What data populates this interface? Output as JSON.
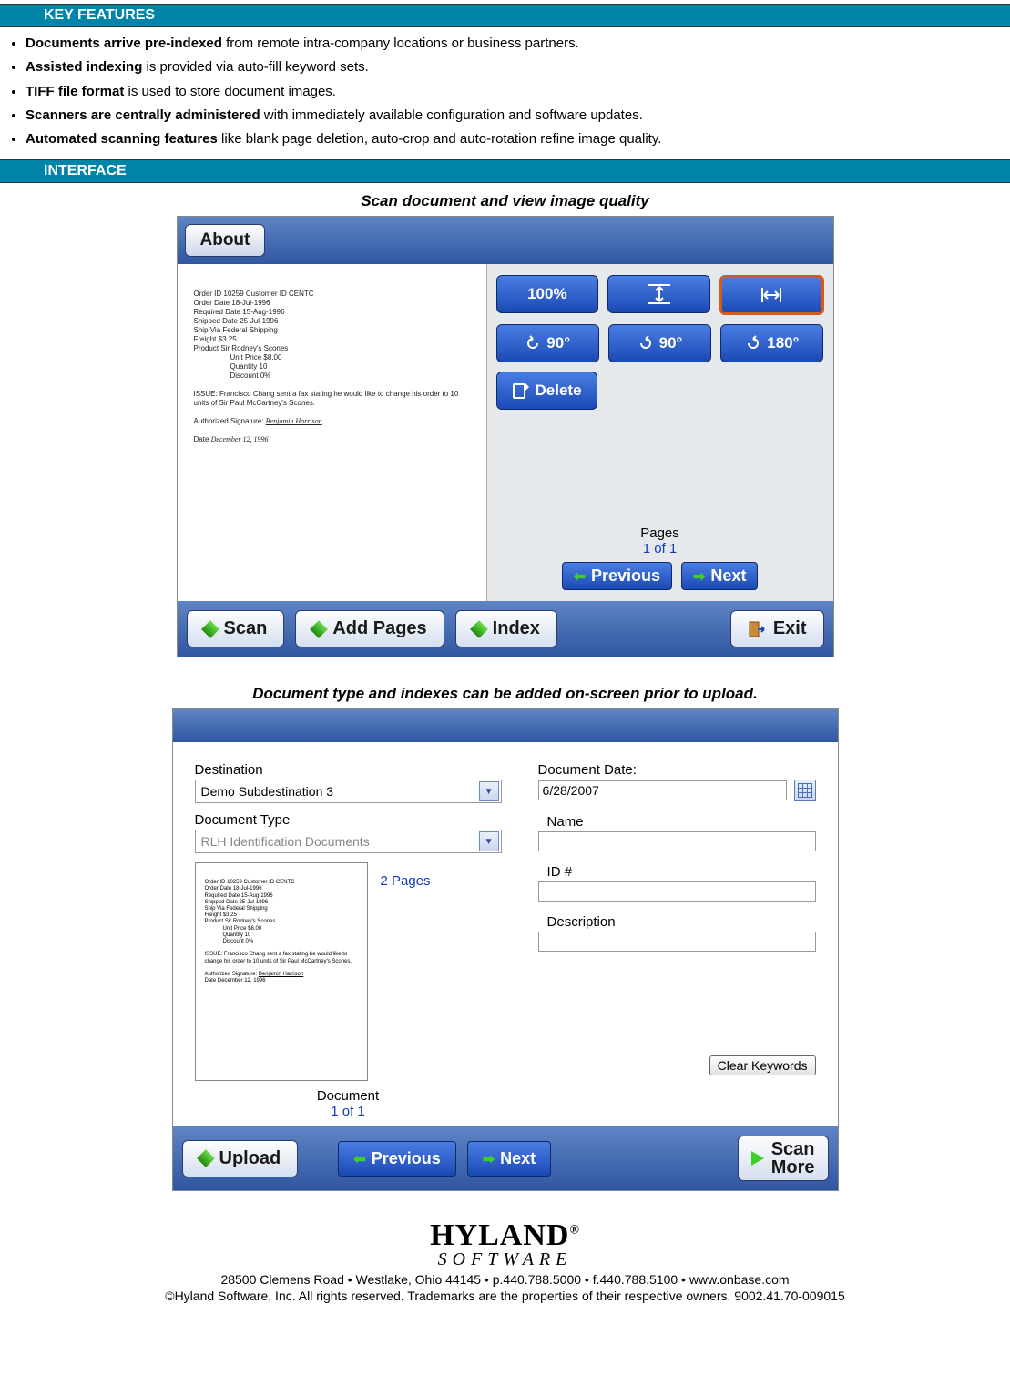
{
  "sections": {
    "key_features": "KEY FEATURES",
    "interface": "INTERFACE"
  },
  "features": [
    {
      "bold": "Documents arrive pre-indexed",
      "rest": " from remote intra-company locations or business partners."
    },
    {
      "bold": "Assisted indexing",
      "rest": " is provided via auto-fill keyword sets."
    },
    {
      "bold": "TIFF file format",
      "rest": " is used to store document images."
    },
    {
      "bold": "Scanners are centrally administered",
      "rest": " with immediately available configuration and software updates."
    },
    {
      "bold": "Automated scanning features",
      "rest": " like blank page deletion, auto-crop and auto-rotation refine image quality."
    }
  ],
  "captions": {
    "scan": "Scan document and view image quality",
    "index": "Document type and indexes can be added on-screen prior to upload."
  },
  "scanUI": {
    "about": "About",
    "zoom100": "100%",
    "rotLeft": "90°",
    "rotRight": "90°",
    "rot180": "180°",
    "delete": "Delete",
    "pages_label": "Pages",
    "pages_value": "1 of 1",
    "previous": "Previous",
    "next": "Next",
    "scan": "Scan",
    "addPages": "Add Pages",
    "index": "Index",
    "exit": "Exit"
  },
  "doc_preview": {
    "l1": "Order ID    10259     Customer ID    CENTC",
    "l2": "Order Date       18-Jul-1996",
    "l3": "Required Date   15-Aug-1996",
    "l4": "Shipped Date    25-Jul-1996",
    "l5": "Ship Via   Federal Shipping",
    "l6": "Freight    $3.25",
    "l7": "Product   Sir Rodney's Scones",
    "l8": "Unit Price    $8.00",
    "l9": "Quantity       10",
    "l10": "Discount      0%",
    "issue": "ISSUE:  Francisco Chang sent a fax stating he would like to change his order to 10 units of Sir Paul McCartney's Scones.",
    "sig_label": "Authorized Signature:",
    "sig": "Benjamin Harrison",
    "date_label": "Date",
    "date_val": "December 12, 1996"
  },
  "indexUI": {
    "destination_label": "Destination",
    "destination_value": "Demo Subdestination 3",
    "doctype_label": "Document Type",
    "doctype_value": "RLH Identification Documents",
    "docdate_label": "Document Date:",
    "docdate_value": "6/28/2007",
    "name_label": "Name",
    "id_label": "ID #",
    "desc_label": "Description",
    "pages_side": "2 Pages",
    "doc_label": "Document",
    "doc_value": "1 of 1",
    "clear": "Clear Keywords",
    "upload": "Upload",
    "previous": "Previous",
    "next": "Next",
    "scan_more_l1": "Scan",
    "scan_more_l2": "More"
  },
  "footer": {
    "brand": "HYLAND",
    "sub": "SOFTWARE",
    "line1": "28500 Clemens Road • Westlake, Ohio 44145 • p.440.788.5000 • f.440.788.5100 • www.onbase.com",
    "line2": "©Hyland Software, Inc. All rights reserved. Trademarks are the properties of their respective owners. 9002.41.70-009015"
  }
}
